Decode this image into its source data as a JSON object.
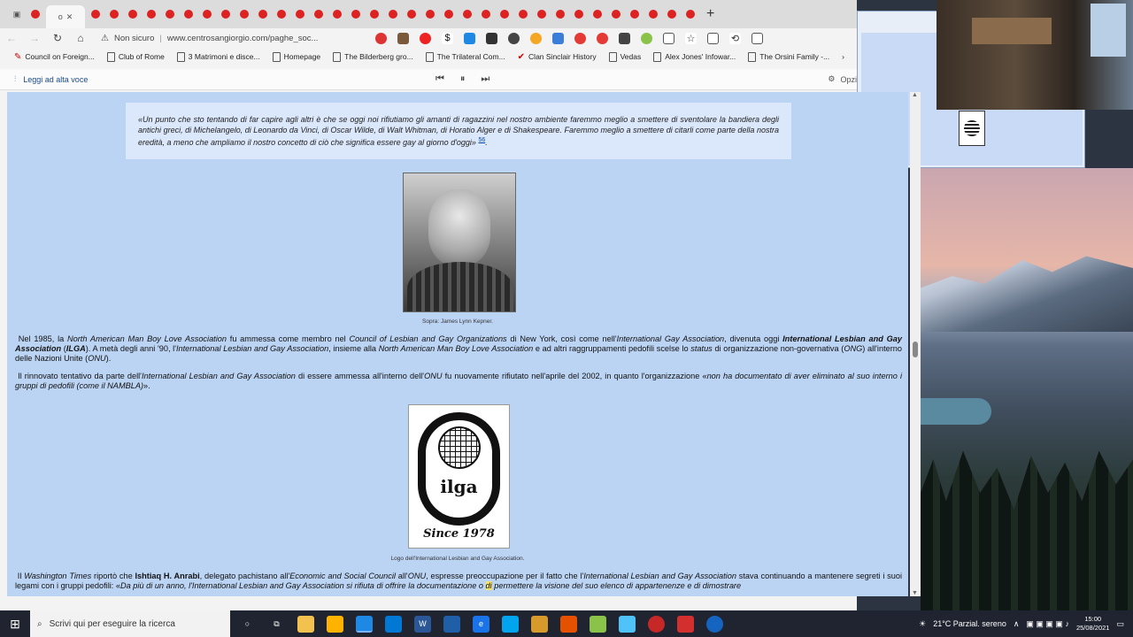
{
  "browser": {
    "tabs_count": 36,
    "address": {
      "security": "Non sicuro",
      "url": "www.centrosangiorgio.com/paghe_soc..."
    },
    "bookmarks": [
      "Council on Foreign...",
      "Club of Rome",
      "3 Matrimoni e disce...",
      "Homepage",
      "The Bilderberg gro...",
      "The Trilateral Com...",
      "Clan Sinclair History",
      "Vedas",
      "Alex Jones' Infowar...",
      "The Orsini Family -..."
    ],
    "read_aloud": {
      "label": "Leggi ad alta voce",
      "options": "Opzi"
    }
  },
  "page": {
    "quote": "«Un punto che sto tentando di far capire agli altri è che se oggi noi rifiutiamo gli amanti di ragazzini nel nostro ambiente faremmo meglio a smettere di sventolare la bandiera degli antichi greci, di Michelangelo, di Leonardo da Vinci, di Oscar Wilde, di Walt Whitman, di Horatio Alger e di Shakespeare. Faremmo meglio a smettere di citarli come parte della nostra eredità, a meno che ampliamo il nostro concetto di ciò che significa essere gay al giorno d'oggi»",
    "quote_ref": "56",
    "photo_caption": "Sopra: James Lynn Kepner.",
    "para1": {
      "a": "Nel 1985, la ",
      "b": "North American Man Boy Love Association",
      "c": " fu ammessa come membro nel ",
      "d": "Council of Lesbian and Gay Organizations",
      "e": " di New York, così come nell'",
      "f": "International Gay Association",
      "g": ", divenuta oggi ",
      "h": "International Lesbian and Gay Association",
      "i": " (",
      "j": "ILGA",
      "k": "). A metà degli anni '90, l'",
      "l": "International Lesbian and Gay Association",
      "m": ", insieme alla ",
      "n": "North American Man Boy Love Association",
      "o": " e ad altri raggruppamenti pedofili scelse lo ",
      "p": "status",
      "q": " di organizzazione non-governativa (",
      "r": "ONG",
      "s": ") all'interno delle Nazioni Unite (",
      "t": "ONU",
      "u": ")."
    },
    "para2": {
      "a": "Il rinnovato tentativo da parte dell'",
      "b": "International Lesbian and Gay Association",
      "c": " di essere ammessa all'interno dell'",
      "d": "ONU",
      "e": " fu nuovamente rifiutato nell'aprile del 2002, in quanto l'organizzazione «",
      "f": "non ha documentato di aver eliminato al suo interno i gruppi di pedofili (come il NAMBLA)",
      "g": "»."
    },
    "logo": {
      "name": "ilga",
      "since": "Since 1978"
    },
    "logo_caption": "Logo dell'International Lesbian and Gay Association.",
    "para3": {
      "a": "Il ",
      "b": "Washington Times",
      "c": " riportò che ",
      "d": "Ishtiaq H. Anrabi",
      "e": ", delegato pachistano all'",
      "f": "Economic and Social Council",
      "g": " all'",
      "h": "ONU",
      "i": ", espresse preoccupazione per il fatto che l'",
      "j": "International Lesbian and Gay Association",
      "k": " stava continuando a mantenere segreti i suoi legami con i gruppi pedofili: «",
      "l": "Da più di un anno, l'International Lesbian and Gay Association si rifiuta di offrire la documentazione o ",
      "m": "di",
      "n": " permettere la visione del suo elenco di appartenenze e di dimostrare"
    }
  },
  "taskbar": {
    "search_placeholder": "Scrivi qui per eseguire la ricerca",
    "weather": "21°C  Parzial. sereno",
    "time": "15:00",
    "date": "25/08/2021"
  }
}
